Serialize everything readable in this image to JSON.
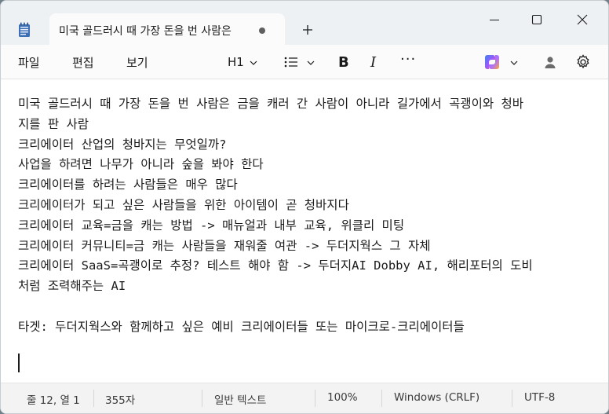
{
  "window": {
    "tab_title": "미국 골드러시 때 가장 돈을 번 사람은",
    "new_tab_symbol": "+"
  },
  "menu": {
    "file": "파일",
    "edit": "편집",
    "view": "보기",
    "heading": "H1",
    "bold": "B",
    "italic": "I",
    "more": "···"
  },
  "editor": {
    "lines": [
      "미국 골드러시 때 가장 돈을 번 사람은 금을 캐러 간 사람이 아니라 길가에서 곡괭이와 청바",
      "지를 판 사람",
      "크리에이터 산업의 청바지는 무엇일까?",
      "사업을 하려면 나무가 아니라 숲을 봐야 한다",
      "크리에이터를 하려는 사람들은 매우 많다",
      "크리에이터가 되고 싶은 사람들을 위한 아이템이 곧 청바지다",
      "크리에이터 교육=금을 캐는 방법 -> 매뉴얼과 내부 교육, 위클리 미팅",
      "크리에이터 커뮤니티=금 캐는 사람들을 재워줄 여관 -> 두더지웍스 그 자체",
      "크리에이터 SaaS=곡괭이로 추정? 테스트 해야 함 -> 두더지AI Dobby AI, 해리포터의 도비",
      "처럼 조력해주는 AI",
      "",
      "타겟: 두더지웍스와 함께하고 싶은 예비 크리에이터들 또는 마이크로-크리에이터들",
      ""
    ]
  },
  "status": {
    "position": "줄 12, 열 1",
    "char_count": "355자",
    "format": "일반 텍스트",
    "zoom": "100%",
    "line_ending": "Windows (CRLF)",
    "encoding": "UTF-8"
  },
  "colors": {
    "titlebar": "#edf1f4",
    "copilot_gradient": [
      "#3b82f6",
      "#a855f7",
      "#f59e0b"
    ]
  }
}
